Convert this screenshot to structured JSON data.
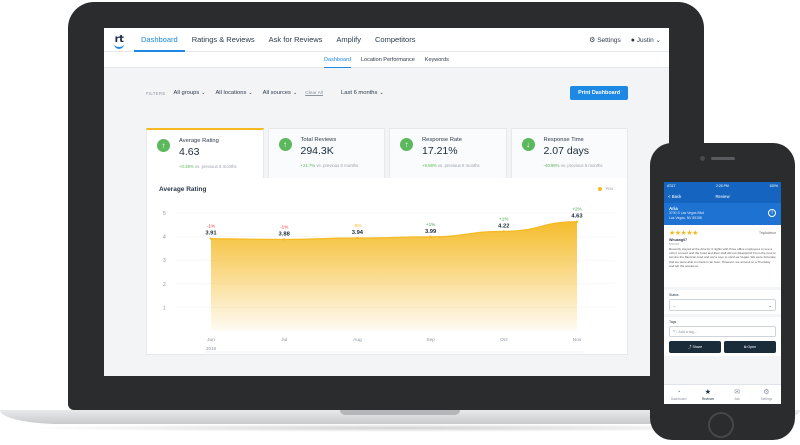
{
  "nav": {
    "logo": "rt",
    "items": [
      "Dashboard",
      "Ratings & Reviews",
      "Ask for Reviews",
      "Amplify",
      "Competitors"
    ],
    "settings": "Settings",
    "user": "Justin"
  },
  "subnav": [
    "Dashboard",
    "Location Performance",
    "Keywords"
  ],
  "filters": {
    "label": "FILTERS",
    "groups": "All groups",
    "locations": "All locations",
    "sources": "All sources",
    "clear": "Clear All",
    "period": "Last 6 months",
    "print": "Print Dashboard"
  },
  "cards": [
    {
      "title": "Average Rating",
      "value": "4.63",
      "delta": "+0.38%",
      "suffix": "vs. previous 6 months",
      "dir": "up",
      "color": "#5cb85c"
    },
    {
      "title": "Total Reviews",
      "value": "294.3K",
      "delta": "+21.7%",
      "suffix": "vs. previous 6 months",
      "dir": "up",
      "color": "#5cb85c"
    },
    {
      "title": "Response Rate",
      "value": "17.21%",
      "delta": "+9.58%",
      "suffix": "vs. previous 6 months",
      "dir": "up",
      "color": "#5cb85c"
    },
    {
      "title": "Response Time",
      "value": "2.07 days",
      "delta": "-40.98%",
      "suffix": "vs. previous 6 months",
      "dir": "down",
      "color": "#5cb85c"
    }
  ],
  "chart_data": {
    "type": "area",
    "title": "Average Rating",
    "legend": "You",
    "categories": [
      "Jun",
      "Jul",
      "Aug",
      "Sep",
      "Oct",
      "Nov"
    ],
    "year_label": "2018",
    "values": [
      3.91,
      3.88,
      3.94,
      3.99,
      4.22,
      4.63
    ],
    "changes": [
      "-1%",
      "-1%",
      "-5%",
      "+1%",
      "+1%",
      "+2%"
    ],
    "change_colors": [
      "#e53935",
      "#e53935",
      "#f5b921",
      "#43a047",
      "#43a047",
      "#43a047"
    ],
    "ylim": [
      0,
      5
    ],
    "yticks": [
      1,
      2,
      3,
      4,
      5
    ],
    "color": "#f5b921"
  },
  "phone": {
    "status_left": "AT&T",
    "status_time": "2:26 PM",
    "status_right": "100%",
    "back": "< Back",
    "title": "Review",
    "biz_name": "Aria",
    "biz_addr1": "3730 S Las Vegas Blvd",
    "biz_addr2": "Las Vegas, NV 89158",
    "source": "TripAdvisor",
    "reviewer": "Whuang07",
    "date": "5/06/18",
    "review_text": "Recently stayed at the Aria for 3 nights with three office employees to see a mirror concert and the hotel and their staff did not disappoint! From the pool to service the Mexican food and we're love to visit Las Vegas. We were fortunate that we were able to check in an hour. However, we arrived on a Thursday and left the weekend.",
    "status_label": "Status",
    "status_value": "--",
    "tags_label": "Tags",
    "tags_placeholder": "Add a tag...",
    "share": "Share",
    "open": "Open",
    "tabs": [
      "Dashboard",
      "Reviews",
      "Ask",
      "Settings"
    ]
  }
}
